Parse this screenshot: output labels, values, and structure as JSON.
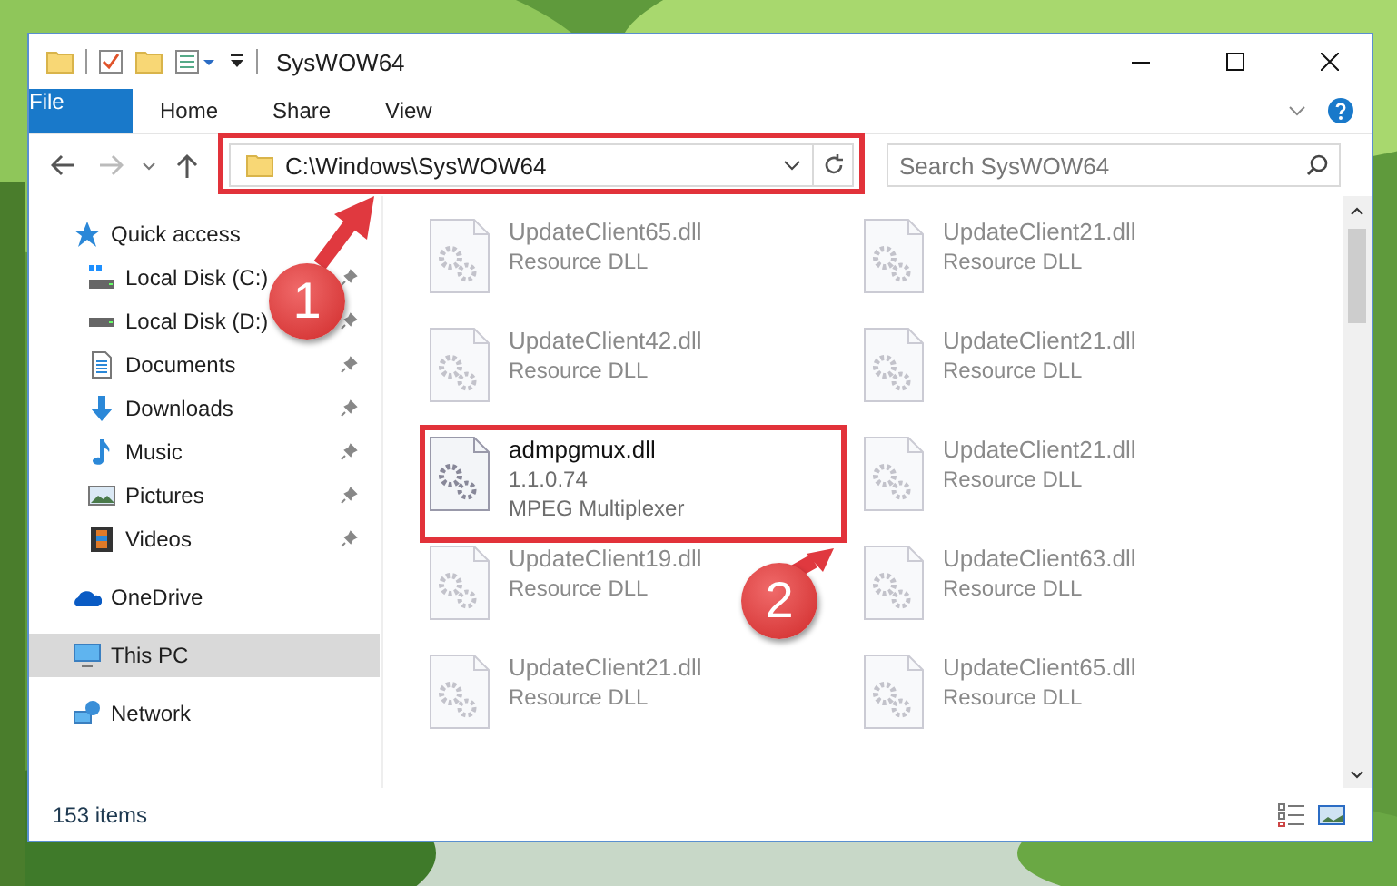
{
  "window": {
    "title": "SysWOW64"
  },
  "ribbon_tabs": [
    {
      "label": "File",
      "kind": "file",
      "selected": false
    },
    {
      "label": "Home",
      "kind": "tab",
      "selected": false
    },
    {
      "label": "Share",
      "kind": "tab",
      "selected": false
    },
    {
      "label": "View",
      "kind": "tab",
      "selected": false
    }
  ],
  "address_bar": {
    "path": "C:\\Windows\\SysWOW64"
  },
  "search": {
    "placeholder": "Search SysWOW64"
  },
  "sidebar": {
    "items": [
      {
        "label": "Quick access",
        "kind": "star",
        "selected": false,
        "children": [
          {
            "label": "Local Disk (C:)",
            "kind": "system-drive",
            "pinned": true,
            "selected": false
          },
          {
            "label": "Local Disk (D:)",
            "kind": "drive",
            "pinned": true,
            "selected": false
          },
          {
            "label": "Documents",
            "kind": "documents",
            "pinned": true,
            "selected": false
          },
          {
            "label": "Downloads",
            "kind": "downloads",
            "pinned": true,
            "selected": false
          },
          {
            "label": "Music",
            "kind": "music",
            "pinned": true,
            "selected": false
          },
          {
            "label": "Pictures",
            "kind": "pictures",
            "pinned": true,
            "selected": false
          },
          {
            "label": "Videos",
            "kind": "videos",
            "pinned": true,
            "selected": false
          }
        ]
      },
      {
        "label": "OneDrive",
        "kind": "cloud",
        "selected": false
      },
      {
        "label": "This PC",
        "kind": "computer",
        "selected": true
      },
      {
        "label": "Network",
        "kind": "network",
        "selected": false
      }
    ]
  },
  "files": [
    {
      "name": "UpdateClient65.dll",
      "details": [
        "Resource DLL"
      ],
      "faded": true
    },
    {
      "name": "UpdateClient21.dll",
      "details": [
        "Resource DLL"
      ],
      "faded": true
    },
    {
      "name": "UpdateClient42.dll",
      "details": [
        "Resource DLL"
      ],
      "faded": true
    },
    {
      "name": "UpdateClient21.dll",
      "details": [
        "Resource DLL"
      ],
      "faded": true
    },
    {
      "name": "admpgmux.dll",
      "details": [
        "1.1.0.74",
        "MPEG Multiplexer"
      ],
      "faded": false
    },
    {
      "name": "UpdateClient21.dll",
      "details": [
        "Resource DLL"
      ],
      "faded": true
    },
    {
      "name": "UpdateClient19.dll",
      "details": [
        "Resource DLL"
      ],
      "faded": true
    },
    {
      "name": "UpdateClient63.dll",
      "details": [
        "Resource DLL"
      ],
      "faded": true
    },
    {
      "name": "UpdateClient21.dll",
      "details": [
        "Resource DLL"
      ],
      "faded": true
    },
    {
      "name": "UpdateClient65.dll",
      "details": [
        "Resource DLL"
      ],
      "faded": true
    }
  ],
  "status_bar": {
    "item_count": "153 items"
  },
  "annotations": [
    {
      "label": "1"
    },
    {
      "label": "2"
    }
  ]
}
